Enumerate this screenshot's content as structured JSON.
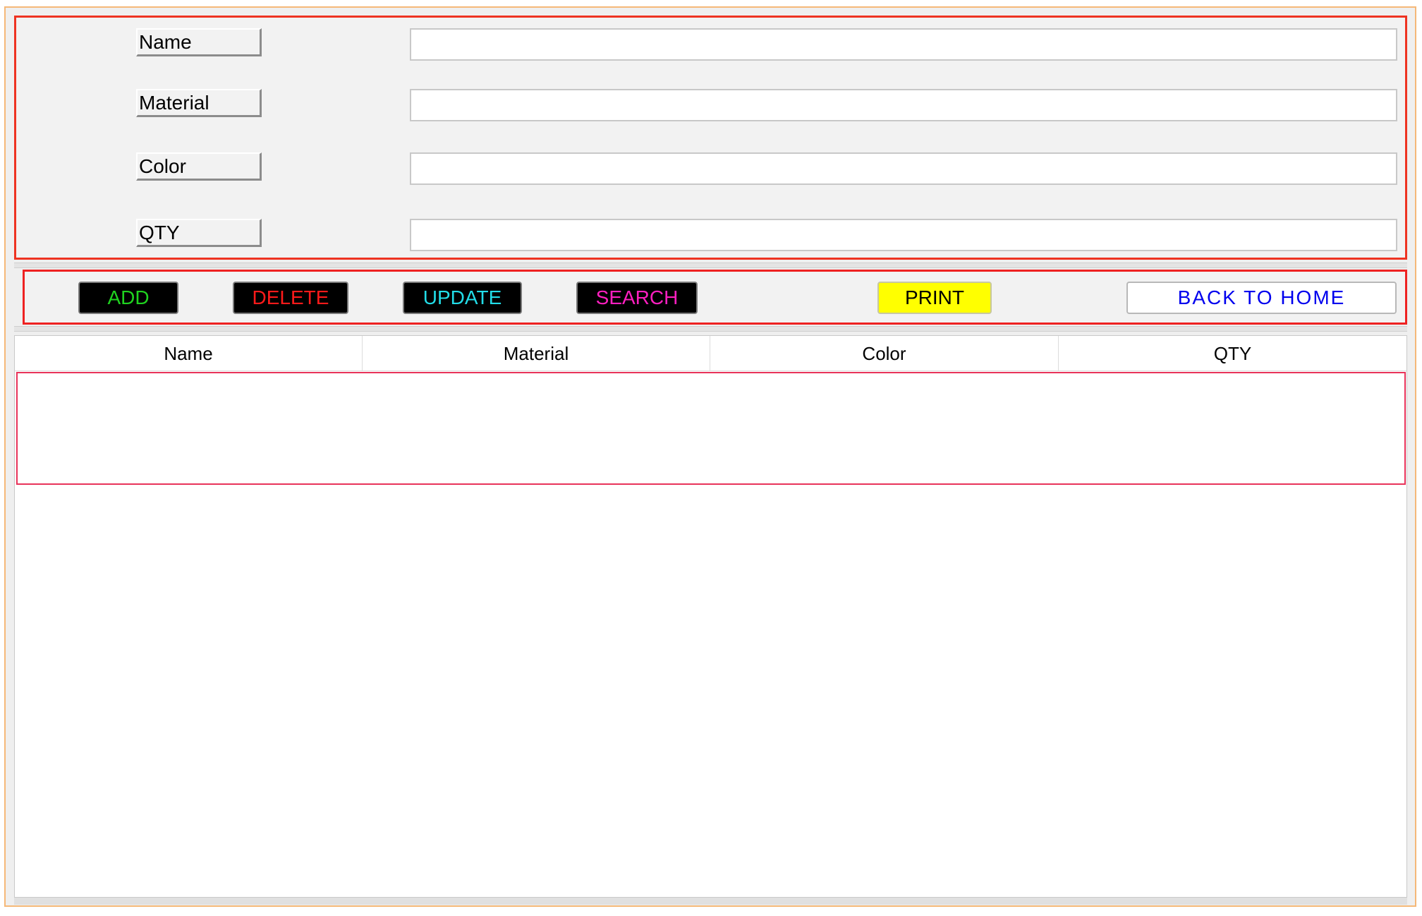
{
  "form": {
    "fields": [
      {
        "label": "Name",
        "value": ""
      },
      {
        "label": "Material",
        "value": ""
      },
      {
        "label": "Color",
        "value": ""
      },
      {
        "label": "QTY",
        "value": ""
      }
    ]
  },
  "toolbar": {
    "add_label": "ADD",
    "delete_label": "DELETE",
    "update_label": "UPDATE",
    "search_label": "SEARCH",
    "print_label": "PRINT",
    "back_label": "BACK TO HOME"
  },
  "colors": {
    "add_text": "#1fd21f",
    "delete_text": "#ff1a1a",
    "update_text": "#22dde8",
    "search_text": "#ff1fc0",
    "print_bg": "#ffff00",
    "back_text": "#0000ee",
    "panel_border": "#ee3322"
  },
  "table": {
    "columns": [
      "Name",
      "Material",
      "Color",
      "QTY"
    ],
    "rows": []
  }
}
